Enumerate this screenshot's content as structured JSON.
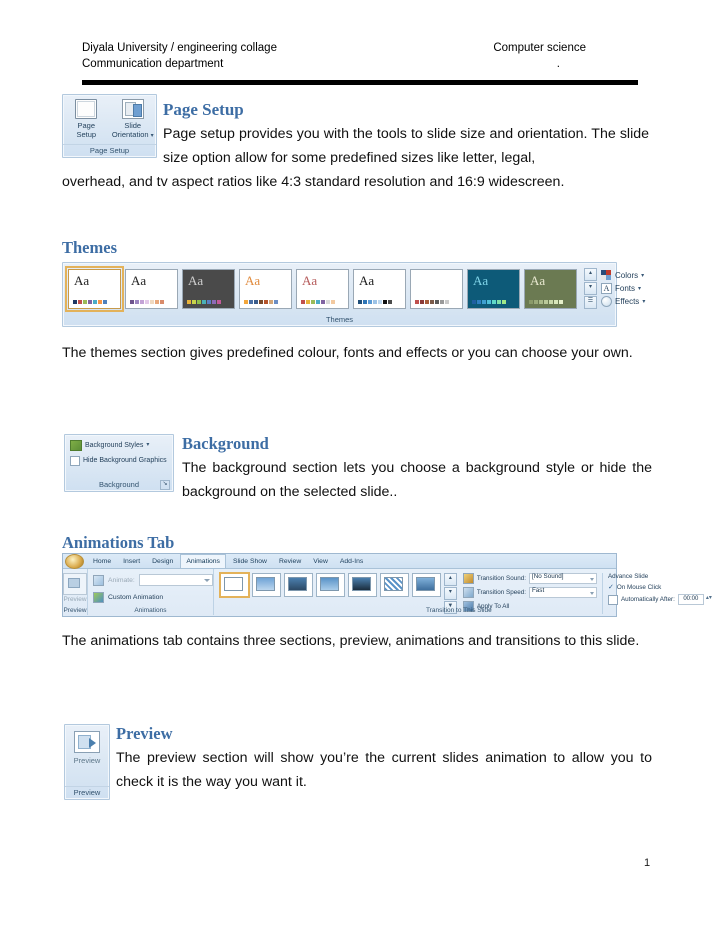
{
  "header": {
    "left_line1": "Diyala University / engineering collage",
    "left_line2": "Communication department",
    "right_line1": "Computer science",
    "right_line2": "."
  },
  "page_setup": {
    "heading": "Page Setup",
    "paragraph_line1": "Page setup provides you with the tools to slide size and orientation.  The slide size option allow for some predefined sizes like letter, legal,",
    "paragraph_line2": "overhead, and tv aspect ratios like 4:3 standard resolution and 16:9 widescreen.",
    "ribbon": {
      "group_label": "Page Setup",
      "buttons": [
        {
          "label_line1": "Page",
          "label_line2": "Setup",
          "icon": "page-setup-icon"
        },
        {
          "label_line1": "Slide",
          "label_line2": "Orientation",
          "icon": "slide-orientation-icon",
          "has_caret": true
        }
      ]
    }
  },
  "themes": {
    "heading": "Themes",
    "paragraph": "The themes section gives predefined colour, fonts and effects or you can choose your own.",
    "ribbon": {
      "group_label": "Themes",
      "thumbnails": [
        {
          "name": "office-theme",
          "aa": "Aa",
          "selected": true,
          "bg": "#ffffff",
          "aa_color": "#222222",
          "swatches": [
            "#1f3864",
            "#c0504d",
            "#9bbb59",
            "#8064a2",
            "#4bacc6",
            "#f79646",
            "#4f81bd"
          ]
        },
        {
          "name": "apex-theme",
          "aa": "Aa",
          "selected": false,
          "bg": "#ffffff",
          "aa_color": "#222222",
          "swatches": [
            "#6e548d",
            "#9c85c0",
            "#c3a3d6",
            "#e2c8e8",
            "#f0d9c0",
            "#e8a87c",
            "#d98b6a"
          ]
        },
        {
          "name": "aspect-theme",
          "aa": "Aa",
          "selected": false,
          "bg": "#4a4a4a",
          "aa_color": "#cfcfcf",
          "swatches": [
            "#e8b33a",
            "#c9d44a",
            "#8fbf4a",
            "#4ab0b8",
            "#5a7fc4",
            "#8d6bb8",
            "#c25a9a"
          ]
        },
        {
          "name": "civic-theme",
          "aa": "Aa",
          "selected": false,
          "bg": "#ffffff",
          "aa_color": "#e08a3c",
          "swatches": [
            "#f2a63b",
            "#4a6fa5",
            "#3b5c8a",
            "#7a4a2a",
            "#b5532a",
            "#d2a679",
            "#6b8ec4"
          ]
        },
        {
          "name": "concourse-theme",
          "aa": "Aa",
          "selected": false,
          "bg": "#ffffff",
          "aa_color": "#b55a5a",
          "swatches": [
            "#c0504d",
            "#e8b33a",
            "#9bbb59",
            "#4bacc6",
            "#8064a2",
            "#d9d9d9",
            "#f2c9a0"
          ]
        },
        {
          "name": "equity-theme",
          "aa": "Aa",
          "selected": false,
          "bg": "#ffffff",
          "aa_color": "#1a1a1a",
          "swatches": [
            "#1f4e79",
            "#2e75b6",
            "#5b9bd5",
            "#9dc3e6",
            "#bdd7ee",
            "#111111",
            "#4a4a4a"
          ]
        },
        {
          "name": "flow-theme",
          "aa": "Aa",
          "selected": false,
          "bg": "#ffffff",
          "aa_color": "#ffffff",
          "swatches": [
            "#c0504d",
            "#8c3b38",
            "#a65b3a",
            "#7a5a4a",
            "#5a5a5a",
            "#9a9a9a",
            "#c9c9c9"
          ]
        },
        {
          "name": "foundry-theme",
          "aa": "Aa",
          "selected": false,
          "bg": "#0d5a78",
          "aa_color": "#7fd4e8",
          "swatches": [
            "#1f5fa0",
            "#2f7fc0",
            "#3f9fd0",
            "#4fbfd8",
            "#5fd8c8",
            "#7fe0a8",
            "#9fe888"
          ]
        },
        {
          "name": "median-theme",
          "aa": "Aa",
          "selected": false,
          "bg": "#6b7a52",
          "aa_color": "#e8e8d0",
          "swatches": [
            "#8a9a6a",
            "#9aaa7a",
            "#aaba8a",
            "#bac99a",
            "#c9d8aa",
            "#d8e6ba",
            "#e6f0ca"
          ]
        }
      ],
      "side_buttons": [
        {
          "name": "scroll-up-button",
          "glyph": "▴"
        },
        {
          "name": "scroll-down-button",
          "glyph": "▾"
        },
        {
          "name": "more-themes-button",
          "glyph": "☰"
        }
      ],
      "options": [
        {
          "label": "Colors",
          "icon": "colors-icon"
        },
        {
          "label": "Fonts",
          "icon": "fonts-icon",
          "glyph": "A"
        },
        {
          "label": "Effects",
          "icon": "effects-icon"
        }
      ]
    }
  },
  "background": {
    "heading": "Background",
    "paragraph": "The background section lets you choose a background style or hide the background on the selected slide..",
    "ribbon": {
      "group_label": "Background",
      "rows": [
        {
          "label": "Background Styles",
          "icon": "background-styles-icon",
          "has_caret": true
        },
        {
          "label": "Hide Background Graphics",
          "icon": "checkbox-icon",
          "has_caret": false
        }
      ],
      "dialog_launcher": "↘"
    }
  },
  "animations": {
    "heading": "Animations Tab",
    "paragraph": "The animations tab contains three sections, preview, animations and transitions to this slide.",
    "ribbon": {
      "office_button": "office-orb-icon",
      "tabs": [
        "Home",
        "Insert",
        "Design",
        "Animations",
        "Slide Show",
        "Review",
        "View",
        "Add-Ins"
      ],
      "active_tab": "Animations",
      "preview_group": {
        "label": "Preview",
        "button_label": "Preview"
      },
      "animations_group": {
        "label": "Animations",
        "animate_label": "Animate:",
        "animate_value": "",
        "custom_animation_label": "Custom Animation"
      },
      "transition_group": {
        "label": "Transition to This Slide",
        "thumbnails": [
          {
            "name": "no-transition",
            "selected": true
          },
          {
            "name": "blinds-transition",
            "selected": false
          },
          {
            "name": "box-in-transition",
            "selected": false
          },
          {
            "name": "checkerboard-transition",
            "selected": false
          },
          {
            "name": "comb-transition",
            "selected": false
          },
          {
            "name": "dissolve-transition",
            "selected": false
          },
          {
            "name": "fade-transition",
            "selected": false
          }
        ],
        "sound_label": "Transition Sound:",
        "sound_value": "[No Sound]",
        "speed_label": "Transition Speed:",
        "speed_value": "Fast",
        "apply_all_label": "Apply To All",
        "advance_label": "Advance Slide",
        "on_mouse_click_label": "On Mouse Click",
        "on_mouse_click_checked": true,
        "auto_after_label": "Automatically After:",
        "auto_after_checked": false,
        "auto_after_value": "00:00"
      }
    }
  },
  "preview": {
    "heading": "Preview",
    "paragraph": "The preview section will show you’re the current slides animation to allow you to check it is the way you want it.",
    "ribbon": {
      "button_label": "Preview",
      "group_label": "Preview"
    }
  },
  "footer": {
    "page_number": "1"
  },
  "colors": {
    "heading_blue": "#3d6da4",
    "body_black": "#111111",
    "ribbon_blue": "#cfe0f1",
    "selection_gold": "#e3b25a"
  }
}
